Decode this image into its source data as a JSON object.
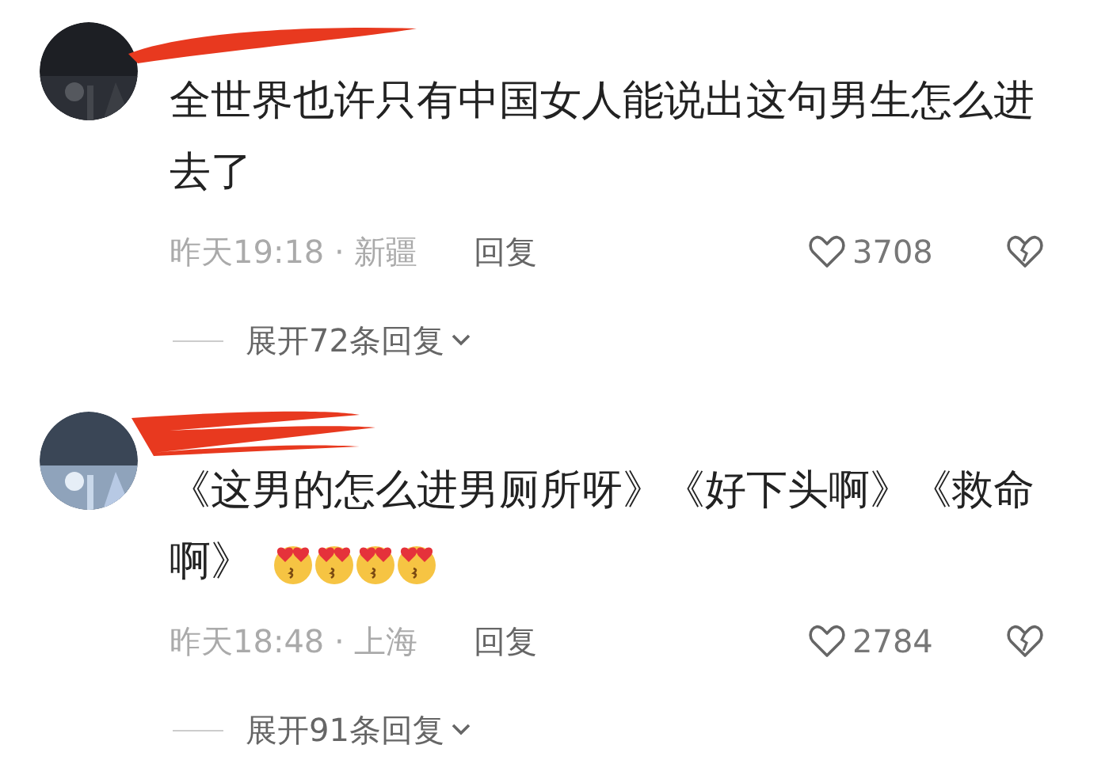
{
  "comments": [
    {
      "redacted_name": true,
      "lines": [
        "全世界也许只有中国女人能说出这句男生怎么进",
        "去了"
      ],
      "time": "昨天19:18 · 新疆",
      "reply": "回复",
      "likes": "3708",
      "expand": "展开72条回复"
    },
    {
      "redacted_name": true,
      "lines": [
        "《这男的怎么进男厕所呀》《好下头啊》《救命",
        "啊》"
      ],
      "emojis": [
        {
          "kind": "heart-eyes-kiss"
        },
        {
          "kind": "heart-eyes-kiss"
        },
        {
          "kind": "heart-eyes-kiss"
        },
        {
          "kind": "heart-eyes-kiss"
        }
      ],
      "time": "昨天18:48 · 上海",
      "reply": "回复",
      "likes": "2784",
      "expand": "展开91条回复"
    }
  ]
}
